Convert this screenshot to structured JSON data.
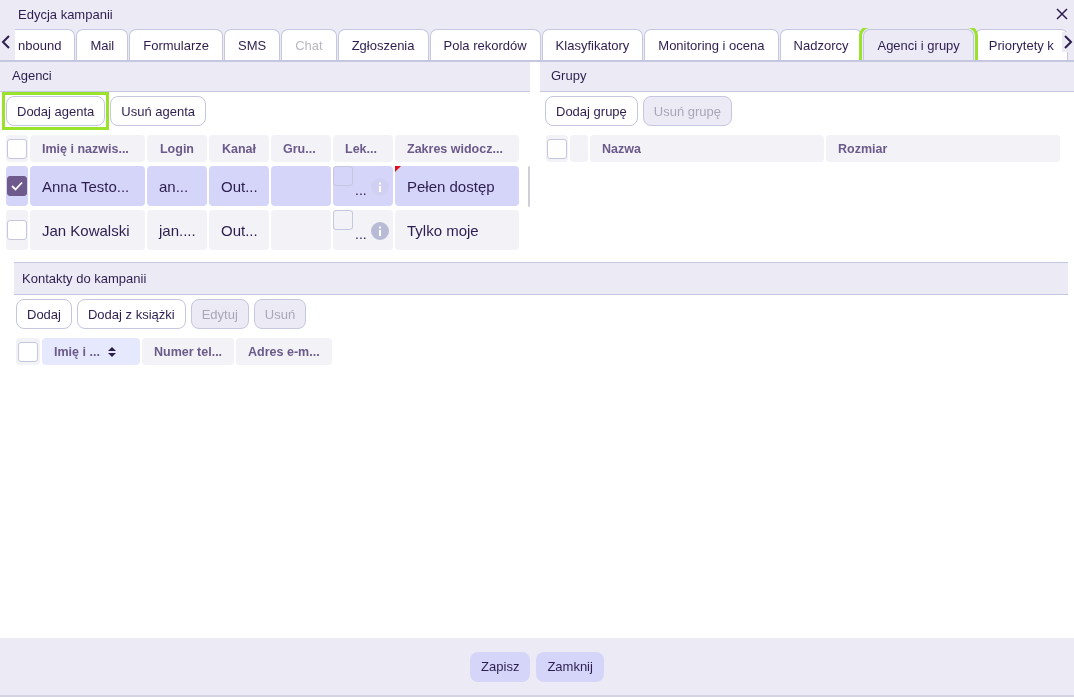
{
  "window": {
    "title": "Edycja kampanii"
  },
  "tabs": [
    {
      "label": "nbound",
      "selected": false,
      "disabled": false,
      "highlighted": false
    },
    {
      "label": "Mail",
      "selected": false,
      "disabled": false,
      "highlighted": false
    },
    {
      "label": "Formularze",
      "selected": false,
      "disabled": false,
      "highlighted": false
    },
    {
      "label": "SMS",
      "selected": false,
      "disabled": false,
      "highlighted": false
    },
    {
      "label": "Chat",
      "selected": false,
      "disabled": true,
      "highlighted": false
    },
    {
      "label": "Zgłoszenia",
      "selected": false,
      "disabled": false,
      "highlighted": false
    },
    {
      "label": "Pola rekordów",
      "selected": false,
      "disabled": false,
      "highlighted": false
    },
    {
      "label": "Klasyfikatory",
      "selected": false,
      "disabled": false,
      "highlighted": false
    },
    {
      "label": "Monitoring i ocena",
      "selected": false,
      "disabled": false,
      "highlighted": false
    },
    {
      "label": "Nadzorcy",
      "selected": false,
      "disabled": false,
      "highlighted": false
    },
    {
      "label": "Agenci i grupy",
      "selected": true,
      "disabled": false,
      "highlighted": true
    },
    {
      "label": "Priorytety k",
      "selected": false,
      "disabled": false,
      "highlighted": false
    }
  ],
  "agents": {
    "title": "Agenci",
    "buttons": [
      {
        "label": "Dodaj agenta",
        "disabled": false,
        "highlighted": true
      },
      {
        "label": "Usuń agenta",
        "disabled": false,
        "highlighted": false
      }
    ],
    "select_all_checked": false,
    "columns": [
      "Imię i nazwis...",
      "Login",
      "Kanał",
      "Gru...",
      "Lek...",
      "Zakres widocz..."
    ],
    "rows": [
      {
        "selected": true,
        "checked": true,
        "name": "Anna Testo...",
        "login": "an...",
        "channel": "Out...",
        "lector_checked": false,
        "lector_text": "...",
        "info_enabled": false,
        "scope": "Pełen dostęp",
        "modified": true
      },
      {
        "selected": false,
        "checked": false,
        "name": "Jan Kowalski",
        "login": "jan....",
        "channel": "Out...",
        "lector_checked": false,
        "lector_text": "...",
        "info_enabled": true,
        "scope": "Tylko moje",
        "modified": false
      }
    ]
  },
  "groups": {
    "title": "Grupy",
    "buttons": [
      {
        "label": "Dodaj grupę",
        "disabled": false,
        "highlighted": false
      },
      {
        "label": "Usuń grupę",
        "disabled": true,
        "highlighted": false
      }
    ],
    "select_all_checked": false,
    "columns": [
      "Nazwa",
      "Rozmiar"
    ]
  },
  "contacts": {
    "title": "Kontakty do kampanii",
    "buttons": [
      {
        "label": "Dodaj",
        "disabled": false,
        "highlighted": false
      },
      {
        "label": "Dodaj z książki",
        "disabled": false,
        "highlighted": false
      },
      {
        "label": "Edytuj",
        "disabled": true,
        "highlighted": false
      },
      {
        "label": "Usuń",
        "disabled": true,
        "highlighted": false
      }
    ],
    "select_all_checked": false,
    "columns": [
      {
        "label": "Imię i ...",
        "sorted": true
      },
      {
        "label": "Numer tel...",
        "sorted": false
      },
      {
        "label": "Adres e-m...",
        "sorted": false
      }
    ]
  },
  "footer": {
    "buttons": [
      "Zapisz",
      "Zamknij"
    ]
  }
}
